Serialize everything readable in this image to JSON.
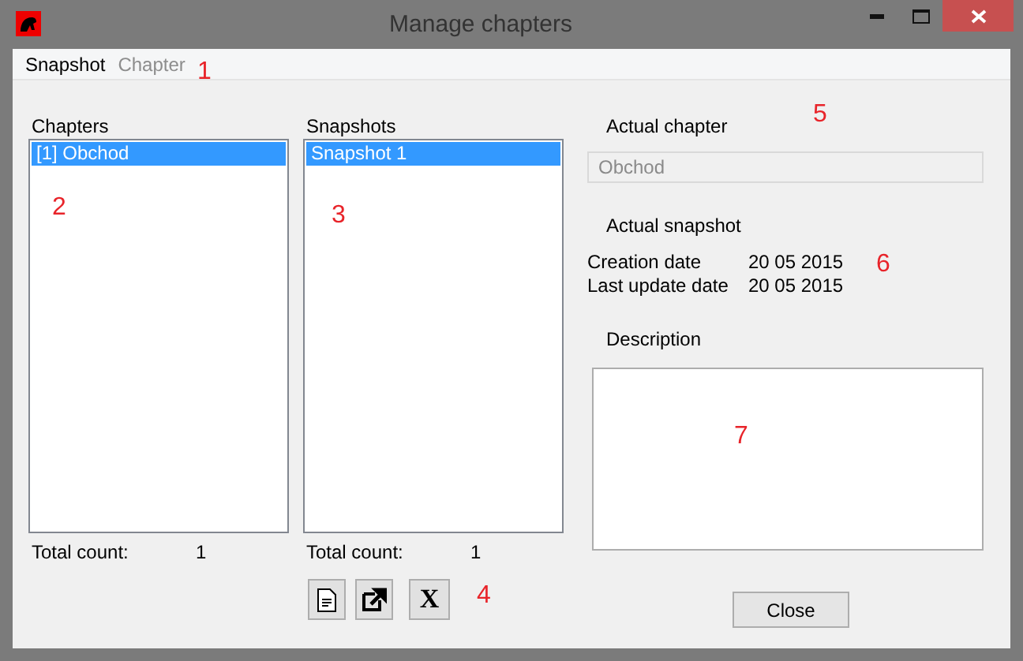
{
  "window": {
    "title": "Manage chapters"
  },
  "menu": [
    {
      "label": "Snapshot",
      "disabled": false
    },
    {
      "label": "Chapter",
      "disabled": true
    }
  ],
  "chapters": {
    "label": "Chapters",
    "items": [
      {
        "label": "[1] Obchod",
        "selected": true
      }
    ],
    "total_label": "Total count:",
    "total": "1"
  },
  "snapshots": {
    "label": "Snapshots",
    "items": [
      {
        "label": "Snapshot 1",
        "selected": true
      }
    ],
    "total_label": "Total count:",
    "total": "1",
    "x_button": "X"
  },
  "actual_chapter": {
    "label": "Actual chapter",
    "value": "Obchod"
  },
  "actual_snapshot": {
    "label": "Actual snapshot",
    "creation_label": "Creation date",
    "creation": "20 05 2015",
    "update_label": "Last update date",
    "update": "20 05 2015"
  },
  "description": {
    "label": "Description"
  },
  "close_button": "Close",
  "annotations": [
    "1",
    "2",
    "3",
    "4",
    "5",
    "6",
    "7"
  ]
}
